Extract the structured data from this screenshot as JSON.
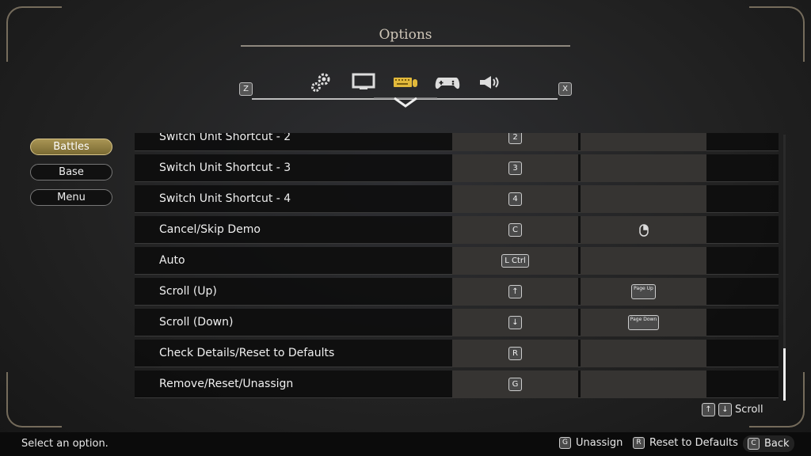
{
  "header": {
    "title": "Options"
  },
  "tabs": {
    "prev_key": "Z",
    "next_key": "X",
    "items": [
      {
        "name": "general",
        "icon": "gears-icon"
      },
      {
        "name": "display",
        "icon": "monitor-icon"
      },
      {
        "name": "keyboard-mouse",
        "icon": "keyboard-mouse-icon",
        "active": true
      },
      {
        "name": "gamepad",
        "icon": "gamepad-icon"
      },
      {
        "name": "sound",
        "icon": "speaker-icon"
      }
    ],
    "active_color": "#e2b93b"
  },
  "sidebar": {
    "items": [
      {
        "label": "Battles",
        "selected": true
      },
      {
        "label": "Base"
      },
      {
        "label": "Menu"
      }
    ]
  },
  "bindings": [
    {
      "action": "Switch Unit Shortcut - 2",
      "key1": "2",
      "key2": ""
    },
    {
      "action": "Switch Unit Shortcut - 3",
      "key1": "3",
      "key2": ""
    },
    {
      "action": "Switch Unit Shortcut - 4",
      "key1": "4",
      "key2": ""
    },
    {
      "action": "Cancel/Skip Demo",
      "key1": "C",
      "key2": "mouse-right-icon"
    },
    {
      "action": "Auto",
      "key1": "L Ctrl",
      "key2": ""
    },
    {
      "action": "Scroll (Up)",
      "key1": "↑",
      "key2": "Page Up"
    },
    {
      "action": "Scroll (Down)",
      "key1": "↓",
      "key2": "Page Down"
    },
    {
      "action": "Check Details/Reset to Defaults",
      "key1": "R",
      "key2": ""
    },
    {
      "action": "Remove/Reset/Unassign",
      "key1": "G",
      "key2": ""
    }
  ],
  "scroll_hint": {
    "up_key": "↑",
    "down_key": "↓",
    "label": "Scroll"
  },
  "scroll_position": 0.9,
  "footer": {
    "status": "Select an option.",
    "buttons": [
      {
        "key": "G",
        "label": "Unassign"
      },
      {
        "key": "R",
        "label": "Reset to Defaults"
      },
      {
        "key": "C",
        "label": "Back"
      }
    ]
  }
}
